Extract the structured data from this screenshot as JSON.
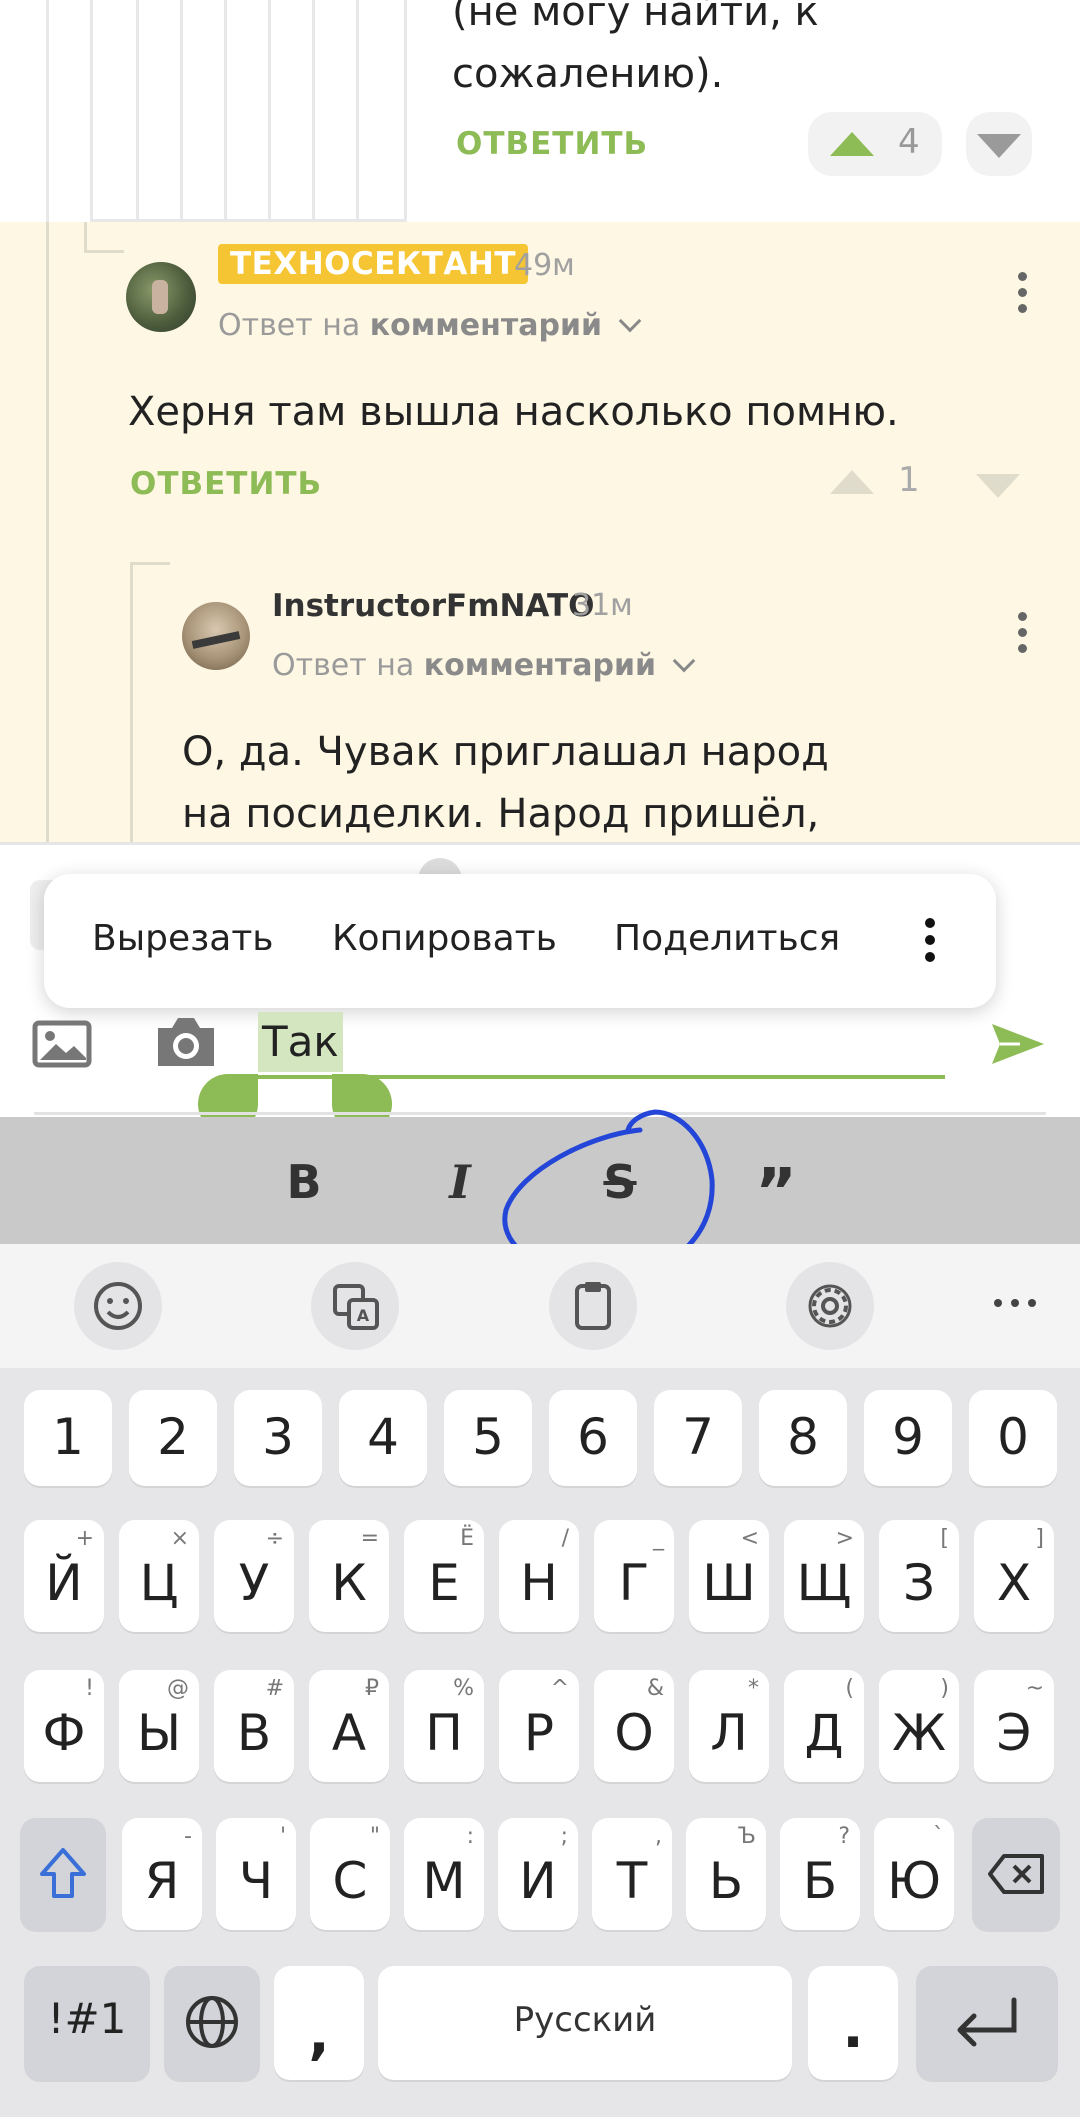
{
  "comments": {
    "c1": {
      "text_lines": [
        "(не могу найти, к",
        "сожалению)."
      ],
      "reply_label": "ОТВЕТИТЬ",
      "votes": "4"
    },
    "c2": {
      "username": "ТЕХНОСЕКТАНТ",
      "time": "49м",
      "reply_prefix": "Ответ на",
      "reply_target": "комментарий",
      "text": "Херня там вышла насколько помню.",
      "reply_label": "ОТВЕТИТЬ",
      "votes": "1"
    },
    "c3": {
      "username": "InstructorFmNATO",
      "time": "31м",
      "reply_prefix": "Ответ на",
      "reply_target": "комментарий",
      "text_lines": [
        "О, да. Чувак приглашал народ",
        "на посиделки. Народ пришёл,"
      ]
    }
  },
  "context_menu": {
    "cut": "Вырезать",
    "copy": "Копировать",
    "share": "Поделиться"
  },
  "editor": {
    "text": "Так"
  },
  "format_bar": {
    "bold": "B",
    "italic": "I",
    "strike": "S",
    "quote": "”"
  },
  "keyboard": {
    "number_row": [
      "1",
      "2",
      "3",
      "4",
      "5",
      "6",
      "7",
      "8",
      "9",
      "0"
    ],
    "row1": [
      {
        "k": "Й",
        "s": "+"
      },
      {
        "k": "Ц",
        "s": "×"
      },
      {
        "k": "У",
        "s": "÷"
      },
      {
        "k": "К",
        "s": "="
      },
      {
        "k": "Е",
        "s": "Ё"
      },
      {
        "k": "Н",
        "s": "/"
      },
      {
        "k": "Г",
        "s": "_"
      },
      {
        "k": "Ш",
        "s": "<"
      },
      {
        "k": "Щ",
        "s": ">"
      },
      {
        "k": "З",
        "s": "["
      },
      {
        "k": "Х",
        "s": "]"
      }
    ],
    "row2": [
      {
        "k": "Ф",
        "s": "!"
      },
      {
        "k": "Ы",
        "s": "@"
      },
      {
        "k": "В",
        "s": "#"
      },
      {
        "k": "А",
        "s": "₽"
      },
      {
        "k": "П",
        "s": "%"
      },
      {
        "k": "Р",
        "s": "^"
      },
      {
        "k": "О",
        "s": "&"
      },
      {
        "k": "Л",
        "s": "*"
      },
      {
        "k": "Д",
        "s": "("
      },
      {
        "k": "Ж",
        "s": ")"
      },
      {
        "k": "Э",
        "s": "~"
      }
    ],
    "row3": [
      {
        "k": "Я",
        "s": "-"
      },
      {
        "k": "Ч",
        "s": "'"
      },
      {
        "k": "С",
        "s": "\""
      },
      {
        "k": "М",
        "s": ":"
      },
      {
        "k": "И",
        "s": ";"
      },
      {
        "k": "Т",
        "s": ","
      },
      {
        "k": "Ь",
        "s": "Ъ"
      },
      {
        "k": "Б",
        "s": "?"
      },
      {
        "k": "Ю",
        "s": "`"
      }
    ],
    "symbols_key": "!#1",
    "comma_key": ",",
    "space_label": "Русский",
    "period_key": "."
  }
}
